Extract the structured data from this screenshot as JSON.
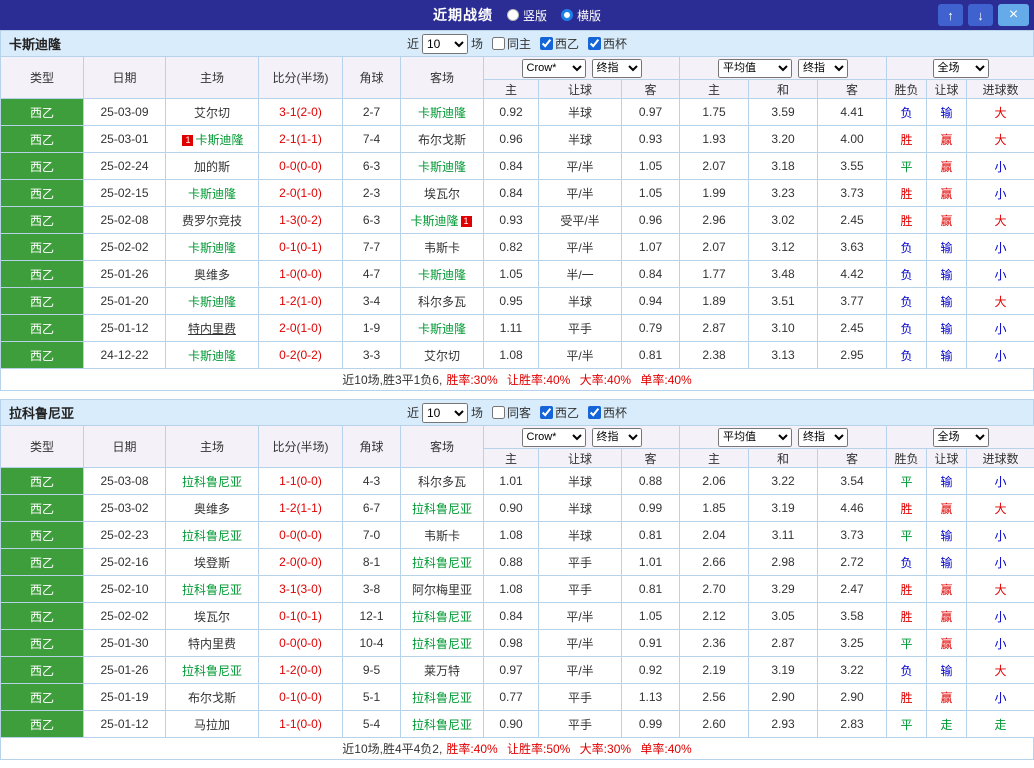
{
  "topbar": {
    "title": "近期战绩",
    "views": [
      {
        "label": "竖版",
        "selected": false
      },
      {
        "label": "横版",
        "selected": true
      }
    ],
    "up": "↑",
    "down": "↓",
    "close": "×"
  },
  "labels": {
    "recent": "近",
    "matches": "场"
  },
  "table_header": {
    "cols": [
      "类型",
      "日期",
      "主场",
      "比分(半场)",
      "角球",
      "客场"
    ],
    "bookmaker": "Crow*",
    "stage": "终指",
    "avg": "平均值",
    "stage2": "终指",
    "scope": "全场",
    "sub": [
      "主",
      "让球",
      "客",
      "主",
      "和",
      "客",
      "胜负",
      "让球",
      "进球数"
    ]
  },
  "result_colors": {
    "胜": "#e10000",
    "平": "#009933",
    "负": "#0000cc",
    "赢": "#e10000",
    "走": "#009933",
    "输": "#0000cc",
    "大": "#e10000",
    "小": "#0000cc"
  },
  "colors": {
    "topbar_bg": "#2b2c94",
    "section_bg": "#d9ecfb",
    "league_green": "#3f9e3c",
    "focus_team_green": "#009933",
    "score_red": "#e10000",
    "border_blue": "#b7d3eb"
  },
  "sections": [
    {
      "team": "卡斯迪隆",
      "filter": {
        "count": "10",
        "checkboxes": [
          {
            "label": "同主",
            "checked": false
          },
          {
            "label": "西乙",
            "checked": true
          },
          {
            "label": "西杯",
            "checked": true
          }
        ]
      },
      "rows": [
        {
          "league": "西乙",
          "date": "25-03-09",
          "home": "艾尔切",
          "score": "3-1(2-0)",
          "corner": "2-7",
          "away": "卡斯迪隆",
          "away_focus": true,
          "odds": [
            "0.92",
            "半球",
            "0.97"
          ],
          "avg": [
            "1.75",
            "3.59",
            "4.41"
          ],
          "results": [
            "负",
            "输",
            "大"
          ]
        },
        {
          "league": "西乙",
          "date": "25-03-01",
          "home": "卡斯迪隆",
          "home_focus": true,
          "home_card": true,
          "score": "2-1(1-1)",
          "corner": "7-4",
          "away": "布尔戈斯",
          "odds": [
            "0.96",
            "半球",
            "0.93"
          ],
          "avg": [
            "1.93",
            "3.20",
            "4.00"
          ],
          "results": [
            "胜",
            "赢",
            "大"
          ]
        },
        {
          "league": "西乙",
          "date": "25-02-24",
          "home": "加的斯",
          "score": "0-0(0-0)",
          "corner": "6-3",
          "away": "卡斯迪隆",
          "away_focus": true,
          "odds": [
            "0.84",
            "平/半",
            "1.05"
          ],
          "avg": [
            "2.07",
            "3.18",
            "3.55"
          ],
          "results": [
            "平",
            "赢",
            "小"
          ]
        },
        {
          "league": "西乙",
          "date": "25-02-15",
          "home": "卡斯迪隆",
          "home_focus": true,
          "score": "2-0(1-0)",
          "corner": "2-3",
          "away": "埃瓦尔",
          "odds": [
            "0.84",
            "平/半",
            "1.05"
          ],
          "avg": [
            "1.99",
            "3.23",
            "3.73"
          ],
          "results": [
            "胜",
            "赢",
            "小"
          ]
        },
        {
          "league": "西乙",
          "date": "25-02-08",
          "home": "费罗尔竞技",
          "score": "1-3(0-2)",
          "corner": "6-3",
          "away": "卡斯迪隆",
          "away_focus": true,
          "away_card": true,
          "odds": [
            "0.93",
            "受平/半",
            "0.96"
          ],
          "avg": [
            "2.96",
            "3.02",
            "2.45"
          ],
          "results": [
            "胜",
            "赢",
            "大"
          ]
        },
        {
          "league": "西乙",
          "date": "25-02-02",
          "home": "卡斯迪隆",
          "home_focus": true,
          "score": "0-1(0-1)",
          "corner": "7-7",
          "away": "韦斯卡",
          "odds": [
            "0.82",
            "平/半",
            "1.07"
          ],
          "avg": [
            "2.07",
            "3.12",
            "3.63"
          ],
          "results": [
            "负",
            "输",
            "小"
          ]
        },
        {
          "league": "西乙",
          "date": "25-01-26",
          "home": "奥维多",
          "score": "1-0(0-0)",
          "corner": "4-7",
          "away": "卡斯迪隆",
          "away_focus": true,
          "odds": [
            "1.05",
            "半/一",
            "0.84"
          ],
          "avg": [
            "1.77",
            "3.48",
            "4.42"
          ],
          "results": [
            "负",
            "输",
            "小"
          ]
        },
        {
          "league": "西乙",
          "date": "25-01-20",
          "home": "卡斯迪隆",
          "home_focus": true,
          "score": "1-2(1-0)",
          "corner": "3-4",
          "away": "科尔多瓦",
          "odds": [
            "0.95",
            "半球",
            "0.94"
          ],
          "avg": [
            "1.89",
            "3.51",
            "3.77"
          ],
          "results": [
            "负",
            "输",
            "大"
          ]
        },
        {
          "league": "西乙",
          "date": "25-01-12",
          "home": "特内里费",
          "home_underline": true,
          "score": "2-0(1-0)",
          "corner": "1-9",
          "away": "卡斯迪隆",
          "away_focus": true,
          "odds": [
            "1.11",
            "平手",
            "0.79"
          ],
          "avg": [
            "2.87",
            "3.10",
            "2.45"
          ],
          "results": [
            "负",
            "输",
            "小"
          ]
        },
        {
          "league": "西乙",
          "date": "24-12-22",
          "home": "卡斯迪隆",
          "home_focus": true,
          "score": "0-2(0-2)",
          "corner": "3-3",
          "away": "艾尔切",
          "odds": [
            "1.08",
            "平/半",
            "0.81"
          ],
          "avg": [
            "2.38",
            "3.13",
            "2.95"
          ],
          "results": [
            "负",
            "输",
            "小"
          ]
        }
      ],
      "summary": {
        "record": "近10场,胜3平1负6,",
        "stats": "胜率:30% 让胜率:40% 大率:40% 单率:40%"
      }
    },
    {
      "team": "拉科鲁尼亚",
      "filter": {
        "count": "10",
        "checkboxes": [
          {
            "label": "同客",
            "checked": false
          },
          {
            "label": "西乙",
            "checked": true
          },
          {
            "label": "西杯",
            "checked": true
          }
        ]
      },
      "rows": [
        {
          "league": "西乙",
          "date": "25-03-08",
          "home": "拉科鲁尼亚",
          "home_focus": true,
          "score": "1-1(0-0)",
          "corner": "4-3",
          "away": "科尔多瓦",
          "odds": [
            "1.01",
            "半球",
            "0.88"
          ],
          "avg": [
            "2.06",
            "3.22",
            "3.54"
          ],
          "results": [
            "平",
            "输",
            "小"
          ]
        },
        {
          "league": "西乙",
          "date": "25-03-02",
          "home": "奥维多",
          "score": "1-2(1-1)",
          "corner": "6-7",
          "away": "拉科鲁尼亚",
          "away_focus": true,
          "odds": [
            "0.90",
            "半球",
            "0.99"
          ],
          "avg": [
            "1.85",
            "3.19",
            "4.46"
          ],
          "results": [
            "胜",
            "赢",
            "大"
          ]
        },
        {
          "league": "西乙",
          "date": "25-02-23",
          "home": "拉科鲁尼亚",
          "home_focus": true,
          "score": "0-0(0-0)",
          "corner": "7-0",
          "away": "韦斯卡",
          "odds": [
            "1.08",
            "半球",
            "0.81"
          ],
          "avg": [
            "2.04",
            "3.11",
            "3.73"
          ],
          "results": [
            "平",
            "输",
            "小"
          ]
        },
        {
          "league": "西乙",
          "date": "25-02-16",
          "home": "埃登斯",
          "score": "2-0(0-0)",
          "corner": "8-1",
          "away": "拉科鲁尼亚",
          "away_focus": true,
          "odds": [
            "0.88",
            "平手",
            "1.01"
          ],
          "avg": [
            "2.66",
            "2.98",
            "2.72"
          ],
          "results": [
            "负",
            "输",
            "小"
          ]
        },
        {
          "league": "西乙",
          "date": "25-02-10",
          "home": "拉科鲁尼亚",
          "home_focus": true,
          "score": "3-1(3-0)",
          "corner": "3-8",
          "away": "阿尔梅里亚",
          "odds": [
            "1.08",
            "平手",
            "0.81"
          ],
          "avg": [
            "2.70",
            "3.29",
            "2.47"
          ],
          "results": [
            "胜",
            "赢",
            "大"
          ]
        },
        {
          "league": "西乙",
          "date": "25-02-02",
          "home": "埃瓦尔",
          "score": "0-1(0-1)",
          "corner": "12-1",
          "away": "拉科鲁尼亚",
          "away_focus": true,
          "odds": [
            "0.84",
            "平/半",
            "1.05"
          ],
          "avg": [
            "2.12",
            "3.05",
            "3.58"
          ],
          "results": [
            "胜",
            "赢",
            "小"
          ]
        },
        {
          "league": "西乙",
          "date": "25-01-30",
          "home": "特内里费",
          "score": "0-0(0-0)",
          "corner": "10-4",
          "away": "拉科鲁尼亚",
          "away_focus": true,
          "odds": [
            "0.98",
            "平/半",
            "0.91"
          ],
          "avg": [
            "2.36",
            "2.87",
            "3.25"
          ],
          "results": [
            "平",
            "赢",
            "小"
          ]
        },
        {
          "league": "西乙",
          "date": "25-01-26",
          "home": "拉科鲁尼亚",
          "home_focus": true,
          "score": "1-2(0-0)",
          "corner": "9-5",
          "away": "莱万特",
          "odds": [
            "0.97",
            "平/半",
            "0.92"
          ],
          "avg": [
            "2.19",
            "3.19",
            "3.22"
          ],
          "results": [
            "负",
            "输",
            "大"
          ]
        },
        {
          "league": "西乙",
          "date": "25-01-19",
          "home": "布尔戈斯",
          "score": "0-1(0-0)",
          "corner": "5-1",
          "away": "拉科鲁尼亚",
          "away_focus": true,
          "odds": [
            "0.77",
            "平手",
            "1.13"
          ],
          "avg": [
            "2.56",
            "2.90",
            "2.90"
          ],
          "results": [
            "胜",
            "赢",
            "小"
          ]
        },
        {
          "league": "西乙",
          "date": "25-01-12",
          "home": "马拉加",
          "score": "1-1(0-0)",
          "corner": "5-4",
          "away": "拉科鲁尼亚",
          "away_focus": true,
          "odds": [
            "0.90",
            "平手",
            "0.99"
          ],
          "avg": [
            "2.60",
            "2.93",
            "2.83"
          ],
          "results": [
            "平",
            "走",
            "走"
          ]
        }
      ],
      "summary": {
        "record": "近10场,胜4平4负2,",
        "stats": "胜率:40% 让胜率:50% 大率:30% 单率:40%"
      }
    }
  ]
}
